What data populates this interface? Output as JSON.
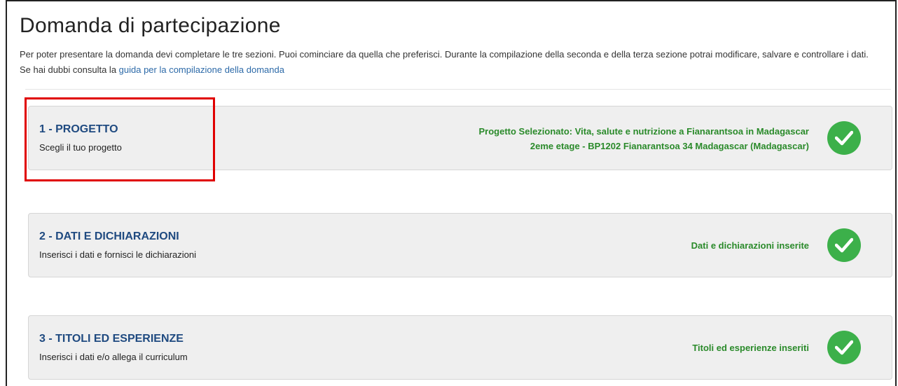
{
  "page": {
    "title": "Domanda di partecipazione",
    "intro_text": "Per poter presentare la domanda devi completare le tre sezioni. Puoi cominciare da quella che preferisci. Durante la compilazione della seconda e della terza sezione potrai modificare, salvare e controllare i dati. Se hai dubbi consulta la ",
    "guide_link": "guida per la compilazione della domanda"
  },
  "sections": [
    {
      "title": "1 - PROGETTO",
      "subtitle": "Scegli il tuo progetto",
      "status_line1": "Progetto Selezionato: Vita, salute e nutrizione a Fianarantsoa in Madagascar",
      "status_line2": "2eme etage - BP1202 Fianarantsoa 34 Madagascar (Madagascar)",
      "icon": "check-circle-icon"
    },
    {
      "title": "2 - DATI E DICHIARAZIONI",
      "subtitle": "Inserisci i dati e fornisci le dichiarazioni",
      "status_line1": "Dati e dichiarazioni inserite",
      "icon": "check-circle-icon"
    },
    {
      "title": "3 - TITOLI ED ESPERIENZE",
      "subtitle": "Inserisci i dati e/o allega il curriculum",
      "status_line1": "Titoli ed esperienze inseriti",
      "icon": "check-circle-icon"
    }
  ],
  "colors": {
    "section_title": "#1f4a80",
    "status_text": "#2a8a2a",
    "check_bg": "#3cb04a",
    "highlight_border": "#e00000",
    "link": "#2d6aa8"
  }
}
